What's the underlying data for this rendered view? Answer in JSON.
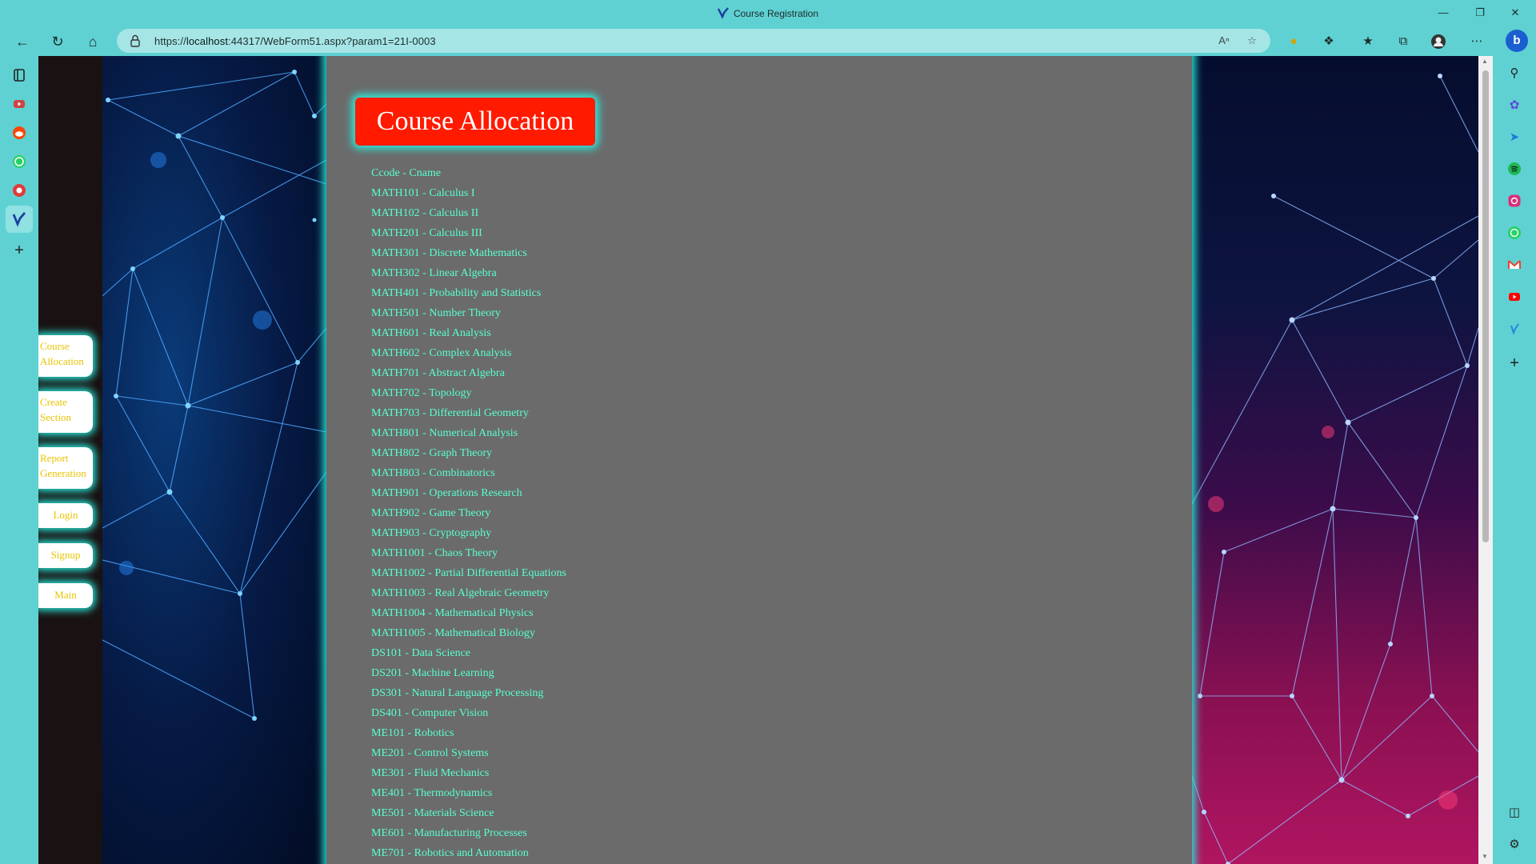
{
  "window": {
    "title": "Course Registration"
  },
  "toolbar": {
    "url_prefix": "https://",
    "url_host": "localhost",
    "url_rest": ":44317/WebForm51.aspx?param1=21I-0003"
  },
  "sidebar": {
    "buttons": [
      {
        "label": "Course Allocation"
      },
      {
        "label": "Create Section"
      },
      {
        "label": "Report Generation"
      },
      {
        "label": "Login"
      },
      {
        "label": "Signup"
      },
      {
        "label": "Main"
      }
    ]
  },
  "main": {
    "title": "Course Allocation",
    "list_header": "Ccode - Cname",
    "courses": [
      "MATH101 - Calculus I",
      "MATH102 - Calculus II",
      "MATH201 - Calculus III",
      "MATH301 - Discrete Mathematics",
      "MATH302 - Linear Algebra",
      "MATH401 - Probability and Statistics",
      "MATH501 - Number Theory",
      "MATH601 - Real Analysis",
      "MATH602 - Complex Analysis",
      "MATH701 - Abstract Algebra",
      "MATH702 - Topology",
      "MATH703 - Differential Geometry",
      "MATH801 - Numerical Analysis",
      "MATH802 - Graph Theory",
      "MATH803 - Combinatorics",
      "MATH901 - Operations Research",
      "MATH902 - Game Theory",
      "MATH903 - Cryptography",
      "MATH1001 - Chaos Theory",
      "MATH1002 - Partial Differential Equations",
      "MATH1003 - Real Algebraic Geometry",
      "MATH1004 - Mathematical Physics",
      "MATH1005 - Mathematical Biology",
      "DS101 - Data Science",
      "DS201 - Machine Learning",
      "DS301 - Natural Language Processing",
      "DS401 - Computer Vision",
      "ME101 - Robotics",
      "ME201 - Control Systems",
      "ME301 - Fluid Mechanics",
      "ME401 - Thermodynamics",
      "ME501 - Materials Science",
      "ME601 - Manufacturing Processes",
      "ME701 - Robotics and Automation"
    ]
  },
  "colors": {
    "title_bg": "#ff1a00",
    "glow": "#2af0e0",
    "course_text": "#58ffd0",
    "button_text": "#e8c400",
    "panel_bg": "#6b6b6b",
    "browser_chrome": "#5fd1d2"
  },
  "icons": {
    "titlebar": [
      "app-logo-icon",
      "minimize-icon",
      "restore-icon",
      "close-icon"
    ],
    "toolbar": [
      "back-icon",
      "refresh-icon",
      "home-icon",
      "lock-icon",
      "read-aloud-icon",
      "add-favorite-icon",
      "extension-yellow-icon",
      "extensions-icon",
      "favorites-icon",
      "collections-icon",
      "profile-icon",
      "more-icon",
      "bing-icon"
    ],
    "left_strip": [
      "tab-actions-icon",
      "youtube-tab-icon",
      "reddit-tab-icon",
      "whatsapp-tab-icon",
      "record-tab-icon",
      "app-tab-icon",
      "new-tab-icon"
    ],
    "right_strip": [
      "search-icon",
      "copilot-icon",
      "send-icon",
      "spotify-icon",
      "instagram-icon",
      "whatsapp-icon",
      "gmail-icon",
      "youtube-icon",
      "app-icon",
      "add-icon",
      "sidebar-toggle-icon",
      "settings-icon"
    ]
  }
}
